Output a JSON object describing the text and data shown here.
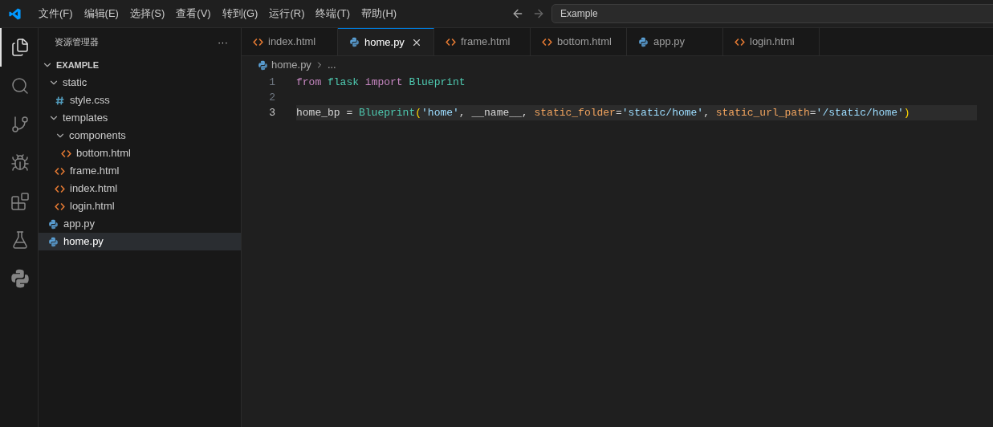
{
  "menu": [
    "文件(F)",
    "编辑(E)",
    "选择(S)",
    "查看(V)",
    "转到(G)",
    "运行(R)",
    "终端(T)",
    "帮助(H)"
  ],
  "search": {
    "value": "Example"
  },
  "activity_bar": [
    {
      "selected": true
    },
    {
      "selected": false
    },
    {
      "selected": false
    },
    {
      "selected": false
    },
    {
      "selected": false
    },
    {
      "selected": false
    },
    {
      "selected": false
    }
  ],
  "explorer": {
    "title": "资源管理器",
    "more": "···",
    "root": {
      "name": "EXAMPLE",
      "expanded": true,
      "children": [
        {
          "name": "static",
          "kind": "folder",
          "expanded": true,
          "children": [
            {
              "name": "style.css",
              "kind": "css",
              "selected": false
            }
          ]
        },
        {
          "name": "templates",
          "kind": "folder",
          "expanded": true,
          "children": [
            {
              "name": "components",
              "kind": "folder",
              "expanded": true,
              "children": [
                {
                  "name": "bottom.html",
                  "kind": "html",
                  "selected": false
                }
              ]
            },
            {
              "name": "frame.html",
              "kind": "html",
              "selected": false
            },
            {
              "name": "index.html",
              "kind": "html",
              "selected": false
            },
            {
              "name": "login.html",
              "kind": "html",
              "selected": false
            }
          ]
        },
        {
          "name": "app.py",
          "kind": "python",
          "selected": false
        },
        {
          "name": "home.py",
          "kind": "python",
          "selected": true
        }
      ]
    }
  },
  "tabs": [
    {
      "label": "index.html",
      "kind": "html",
      "selected": false
    },
    {
      "label": "home.py",
      "kind": "python",
      "selected": true
    },
    {
      "label": "frame.html",
      "kind": "html",
      "selected": false
    },
    {
      "label": "bottom.html",
      "kind": "html",
      "selected": false
    },
    {
      "label": "app.py",
      "kind": "python",
      "selected": false
    },
    {
      "label": "login.html",
      "kind": "html",
      "selected": false
    }
  ],
  "breadcrumb": {
    "file": "home.py",
    "kind": "python",
    "rest": "..."
  },
  "lines": [
    {
      "number": "1",
      "current": false,
      "tokens": [
        {
          "text": "from ",
          "kind": "keyword"
        },
        {
          "text": "flask ",
          "kind": "type"
        },
        {
          "text": "import ",
          "kind": "keyword"
        },
        {
          "text": "Blueprint",
          "kind": "type"
        }
      ]
    },
    {
      "number": "2",
      "current": false
    },
    {
      "number": "3",
      "current": true,
      "tokens": [
        {
          "text": "home_bp = ",
          "kind": "plain"
        },
        {
          "text": "Blueprint",
          "kind": "type"
        },
        {
          "text": "(",
          "kind": "bracket"
        },
        {
          "text": "'home'",
          "kind": "string"
        },
        {
          "text": ", __name__, ",
          "kind": "plain"
        },
        {
          "text": "static_folder",
          "kind": "param"
        },
        {
          "text": "=",
          "kind": "plain"
        },
        {
          "text": "'static/home'",
          "kind": "string"
        },
        {
          "text": ", ",
          "kind": "plain"
        },
        {
          "text": "static_url_path",
          "kind": "param"
        },
        {
          "text": "=",
          "kind": "plain"
        },
        {
          "text": "'/static/home'",
          "kind": "string"
        },
        {
          "text": ")",
          "kind": "bracket"
        }
      ]
    }
  ]
}
